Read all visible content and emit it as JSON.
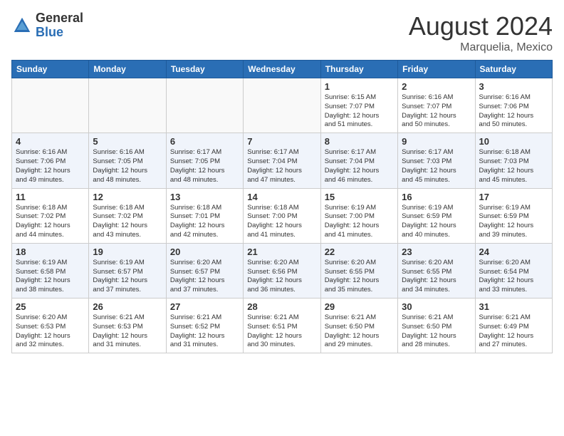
{
  "logo": {
    "general": "General",
    "blue": "Blue"
  },
  "title": {
    "month_year": "August 2024",
    "location": "Marquelia, Mexico"
  },
  "days_of_week": [
    "Sunday",
    "Monday",
    "Tuesday",
    "Wednesday",
    "Thursday",
    "Friday",
    "Saturday"
  ],
  "weeks": [
    [
      {
        "day": "",
        "info": ""
      },
      {
        "day": "",
        "info": ""
      },
      {
        "day": "",
        "info": ""
      },
      {
        "day": "",
        "info": ""
      },
      {
        "day": "1",
        "info": "Sunrise: 6:15 AM\nSunset: 7:07 PM\nDaylight: 12 hours\nand 51 minutes."
      },
      {
        "day": "2",
        "info": "Sunrise: 6:16 AM\nSunset: 7:07 PM\nDaylight: 12 hours\nand 50 minutes."
      },
      {
        "day": "3",
        "info": "Sunrise: 6:16 AM\nSunset: 7:06 PM\nDaylight: 12 hours\nand 50 minutes."
      }
    ],
    [
      {
        "day": "4",
        "info": "Sunrise: 6:16 AM\nSunset: 7:06 PM\nDaylight: 12 hours\nand 49 minutes."
      },
      {
        "day": "5",
        "info": "Sunrise: 6:16 AM\nSunset: 7:05 PM\nDaylight: 12 hours\nand 48 minutes."
      },
      {
        "day": "6",
        "info": "Sunrise: 6:17 AM\nSunset: 7:05 PM\nDaylight: 12 hours\nand 48 minutes."
      },
      {
        "day": "7",
        "info": "Sunrise: 6:17 AM\nSunset: 7:04 PM\nDaylight: 12 hours\nand 47 minutes."
      },
      {
        "day": "8",
        "info": "Sunrise: 6:17 AM\nSunset: 7:04 PM\nDaylight: 12 hours\nand 46 minutes."
      },
      {
        "day": "9",
        "info": "Sunrise: 6:17 AM\nSunset: 7:03 PM\nDaylight: 12 hours\nand 45 minutes."
      },
      {
        "day": "10",
        "info": "Sunrise: 6:18 AM\nSunset: 7:03 PM\nDaylight: 12 hours\nand 45 minutes."
      }
    ],
    [
      {
        "day": "11",
        "info": "Sunrise: 6:18 AM\nSunset: 7:02 PM\nDaylight: 12 hours\nand 44 minutes."
      },
      {
        "day": "12",
        "info": "Sunrise: 6:18 AM\nSunset: 7:02 PM\nDaylight: 12 hours\nand 43 minutes."
      },
      {
        "day": "13",
        "info": "Sunrise: 6:18 AM\nSunset: 7:01 PM\nDaylight: 12 hours\nand 42 minutes."
      },
      {
        "day": "14",
        "info": "Sunrise: 6:18 AM\nSunset: 7:00 PM\nDaylight: 12 hours\nand 41 minutes."
      },
      {
        "day": "15",
        "info": "Sunrise: 6:19 AM\nSunset: 7:00 PM\nDaylight: 12 hours\nand 41 minutes."
      },
      {
        "day": "16",
        "info": "Sunrise: 6:19 AM\nSunset: 6:59 PM\nDaylight: 12 hours\nand 40 minutes."
      },
      {
        "day": "17",
        "info": "Sunrise: 6:19 AM\nSunset: 6:59 PM\nDaylight: 12 hours\nand 39 minutes."
      }
    ],
    [
      {
        "day": "18",
        "info": "Sunrise: 6:19 AM\nSunset: 6:58 PM\nDaylight: 12 hours\nand 38 minutes."
      },
      {
        "day": "19",
        "info": "Sunrise: 6:19 AM\nSunset: 6:57 PM\nDaylight: 12 hours\nand 37 minutes."
      },
      {
        "day": "20",
        "info": "Sunrise: 6:20 AM\nSunset: 6:57 PM\nDaylight: 12 hours\nand 37 minutes."
      },
      {
        "day": "21",
        "info": "Sunrise: 6:20 AM\nSunset: 6:56 PM\nDaylight: 12 hours\nand 36 minutes."
      },
      {
        "day": "22",
        "info": "Sunrise: 6:20 AM\nSunset: 6:55 PM\nDaylight: 12 hours\nand 35 minutes."
      },
      {
        "day": "23",
        "info": "Sunrise: 6:20 AM\nSunset: 6:55 PM\nDaylight: 12 hours\nand 34 minutes."
      },
      {
        "day": "24",
        "info": "Sunrise: 6:20 AM\nSunset: 6:54 PM\nDaylight: 12 hours\nand 33 minutes."
      }
    ],
    [
      {
        "day": "25",
        "info": "Sunrise: 6:20 AM\nSunset: 6:53 PM\nDaylight: 12 hours\nand 32 minutes."
      },
      {
        "day": "26",
        "info": "Sunrise: 6:21 AM\nSunset: 6:53 PM\nDaylight: 12 hours\nand 31 minutes."
      },
      {
        "day": "27",
        "info": "Sunrise: 6:21 AM\nSunset: 6:52 PM\nDaylight: 12 hours\nand 31 minutes."
      },
      {
        "day": "28",
        "info": "Sunrise: 6:21 AM\nSunset: 6:51 PM\nDaylight: 12 hours\nand 30 minutes."
      },
      {
        "day": "29",
        "info": "Sunrise: 6:21 AM\nSunset: 6:50 PM\nDaylight: 12 hours\nand 29 minutes."
      },
      {
        "day": "30",
        "info": "Sunrise: 6:21 AM\nSunset: 6:50 PM\nDaylight: 12 hours\nand 28 minutes."
      },
      {
        "day": "31",
        "info": "Sunrise: 6:21 AM\nSunset: 6:49 PM\nDaylight: 12 hours\nand 27 minutes."
      }
    ]
  ]
}
